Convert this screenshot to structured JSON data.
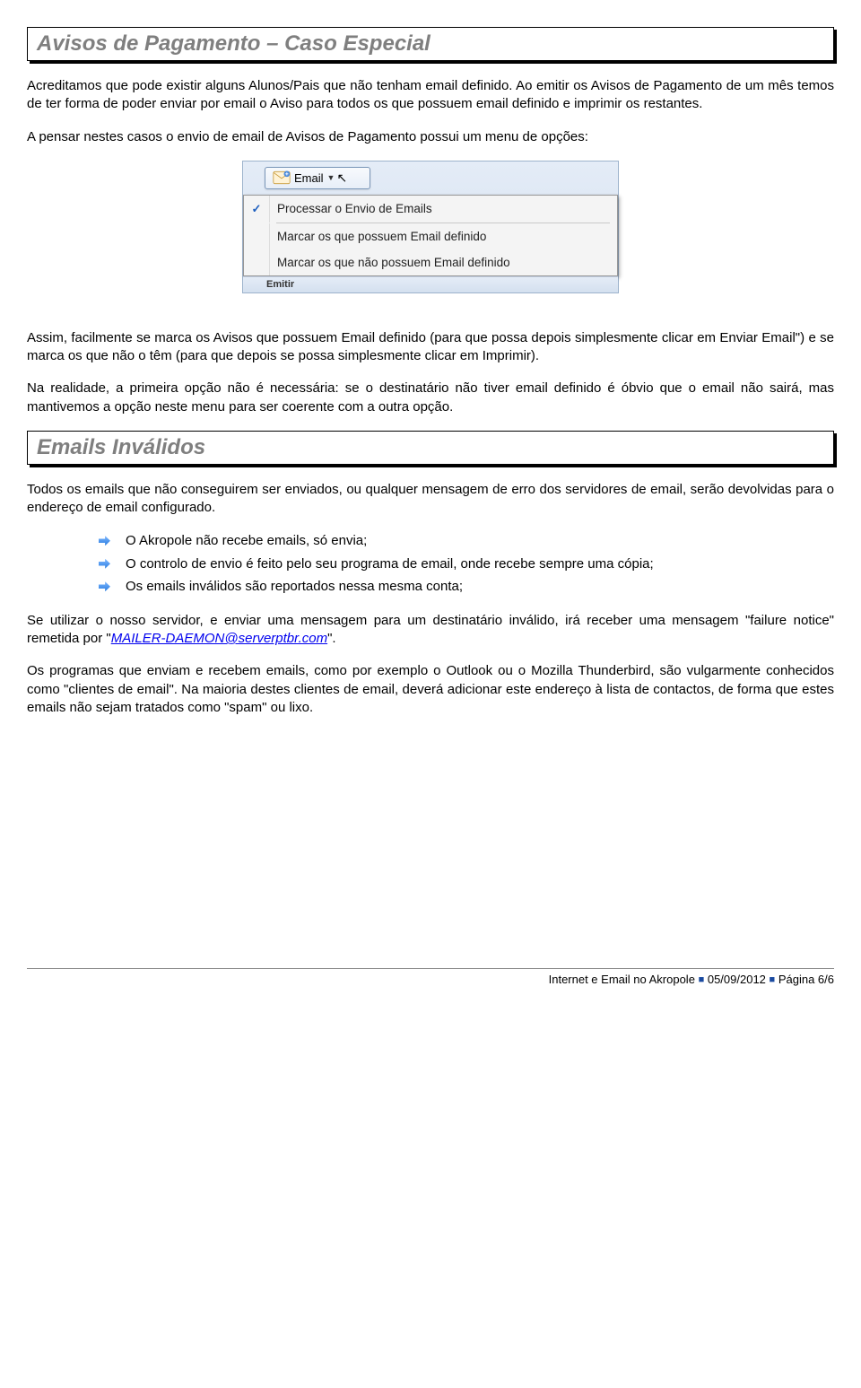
{
  "section1": {
    "title": "Avisos de Pagamento – Caso Especial",
    "p1": "Acreditamos que pode existir alguns Alunos/Pais que não tenham email definido. Ao emitir os Avisos de Pagamento de um mês temos de ter forma de poder enviar por email o Aviso para todos os que possuem email definido e imprimir os restantes.",
    "p2": "A pensar nestes casos o envio de email de Avisos de Pagamento possui um menu de opções:",
    "p3": "Assim, facilmente se marca os Avisos que possuem Email definido (para que possa depois simplesmente clicar em Enviar Email\") e se marca os que não o têm (para que depois se possa simplesmente clicar em Imprimir).",
    "p4": "Na realidade, a primeira opção não é necessária: se o destinatário não tiver email definido é óbvio que o email não sairá, mas mantivemos a opção neste menu para ser coerente com a outra opção."
  },
  "menu": {
    "button": "Email",
    "opt1": "Processar o Envio de Emails",
    "opt2": "Marcar os que possuem Email definido",
    "opt3": "Marcar os que não possuem Email definido",
    "strip": "Emitir"
  },
  "section2": {
    "title": "Emails Inválidos",
    "p1": "Todos os emails que não conseguirem ser enviados, ou qualquer mensagem de erro dos servidores de email, serão devolvidas para o endereço de email configurado.",
    "b1": "O Akropole não recebe emails, só envia;",
    "b2": "O controlo de envio é feito pelo seu programa de email, onde recebe sempre uma cópia;",
    "b3": "Os emails inválidos são reportados nessa mesma conta;",
    "p2a": "Se utilizar o nosso servidor, e enviar uma mensagem para um destinatário inválido, irá receber uma mensagem \"failure notice\" remetida por \"",
    "link": "MAILER-DAEMON@serverptbr.com",
    "p2b": "\".",
    "p3": "Os programas que enviam e recebem emails, como por exemplo o Outlook ou o Mozilla Thunderbird, são vulgarmente conhecidos como \"clientes de email\". Na maioria destes clientes de email, deverá adicionar este endereço à lista de contactos, de forma que estes emails não sejam tratados como \"spam\" ou lixo."
  },
  "footer": {
    "doc": "Internet e Email no Akropole",
    "date": "05/09/2012",
    "page": "Página 6/6"
  }
}
